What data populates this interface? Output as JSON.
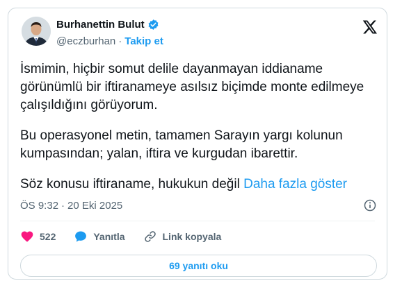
{
  "author": {
    "name": "Burhanettin Bulut",
    "handle": "@eczburhan",
    "separator": "·",
    "follow_label": "Takip et"
  },
  "tweet": {
    "paragraphs": [
      "İsmimin, hiçbir somut delile dayanmayan iddianame görünümlü bir iftiranameye asılsız biçimde monte edilmeye çalışıldığını görüyorum.",
      "Bu operasyonel metin, tamamen Sarayın yargı kolunun kumpasından; yalan, iftira ve kurgudan ibarettir."
    ],
    "last_line": "Söz konusu iftiraname, hukukun değil",
    "show_more": "Daha fazla göster"
  },
  "meta": {
    "time": "ÖS 9:32",
    "separator": "·",
    "date": "20 Eki 2025"
  },
  "actions": {
    "likes": "522",
    "reply_label": "Yanıtla",
    "copy_link_label": "Link kopyala"
  },
  "replies_button": "69 yanıtı oku",
  "colors": {
    "accent": "#1d9bf0",
    "like": "#f91880",
    "text": "#0f1419",
    "muted": "#536471",
    "border": "#cfd9de"
  },
  "icons": [
    "verified-badge-icon",
    "x-logo-icon",
    "info-icon",
    "heart-icon",
    "reply-icon",
    "link-icon"
  ]
}
